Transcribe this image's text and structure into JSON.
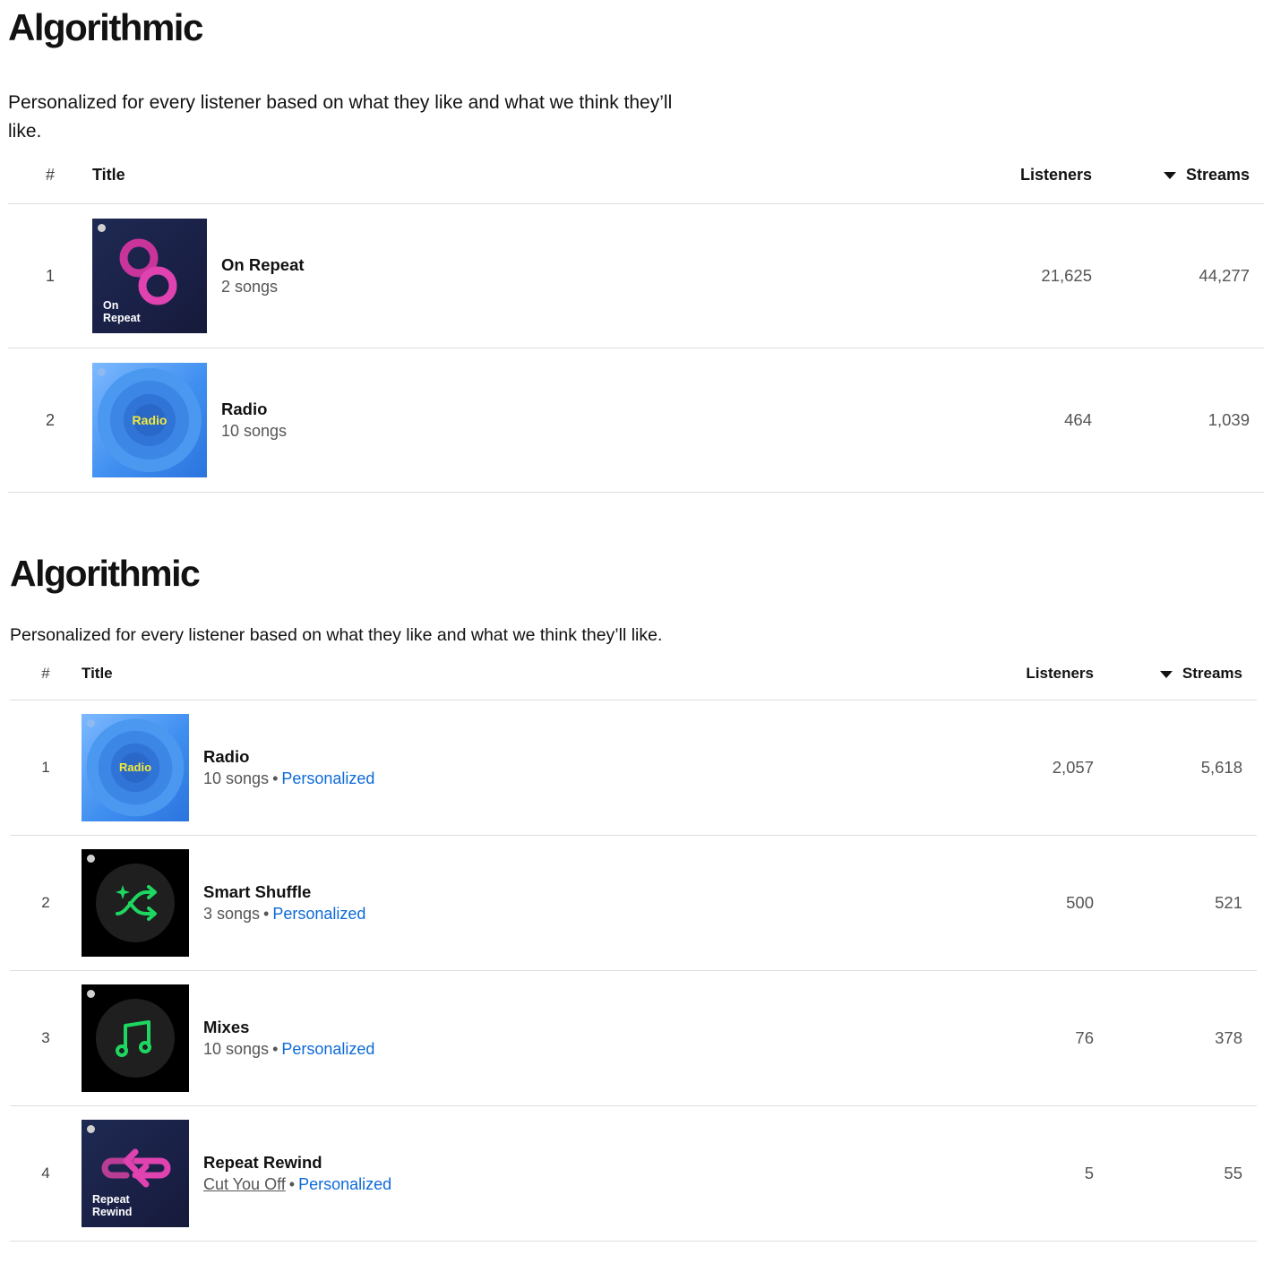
{
  "sections": [
    {
      "heading": "Algorithmic",
      "description": "Personalized for every listener based on what they like and what we think they’ll like.",
      "columns": {
        "num": "#",
        "title": "Title",
        "listeners": "Listeners",
        "streams": "Streams"
      },
      "rows": [
        {
          "rank": "1",
          "name": "On Repeat",
          "sub": "2 songs",
          "listeners": "21,625",
          "streams": "44,277",
          "cover": "on-repeat",
          "cover_label": [
            "On",
            "Repeat"
          ]
        },
        {
          "rank": "2",
          "name": "Radio",
          "sub": "10 songs",
          "listeners": "464",
          "streams": "1,039",
          "cover": "radio",
          "cover_label": [
            "Radio"
          ]
        }
      ]
    },
    {
      "heading": "Algorithmic",
      "description": "Personalized for every listener based on what they like and what we think they’ll like.",
      "columns": {
        "num": "#",
        "title": "Title",
        "listeners": "Listeners",
        "streams": "Streams"
      },
      "rows": [
        {
          "rank": "1",
          "name": "Radio",
          "sub": "10 songs",
          "tag": "Personalized",
          "listeners": "2,057",
          "streams": "5,618",
          "cover": "radio",
          "cover_label": [
            "Radio"
          ]
        },
        {
          "rank": "2",
          "name": "Smart Shuffle",
          "sub": "3 songs",
          "tag": "Personalized",
          "listeners": "500",
          "streams": "521",
          "cover": "smart-shuffle",
          "cover_label": []
        },
        {
          "rank": "3",
          "name": "Mixes",
          "sub": "10 songs",
          "tag": "Personalized",
          "listeners": "76",
          "streams": "378",
          "cover": "mixes",
          "cover_label": []
        },
        {
          "rank": "4",
          "name": "Repeat Rewind",
          "sub_link": "Cut You Off",
          "tag": "Personalized",
          "listeners": "5",
          "streams": "55",
          "cover": "repeat-rewind",
          "cover_label": [
            "Repeat",
            "Rewind"
          ]
        }
      ]
    }
  ],
  "colors": {
    "link": "#0d6ad8",
    "text": "#121212",
    "muted": "#555555",
    "divider": "#dedede",
    "green": "#1ed760",
    "pink": "#e43fa6"
  },
  "icons": {
    "sort": "sort-desc-arrow-icon",
    "logo": "spotify-logo-icon"
  }
}
